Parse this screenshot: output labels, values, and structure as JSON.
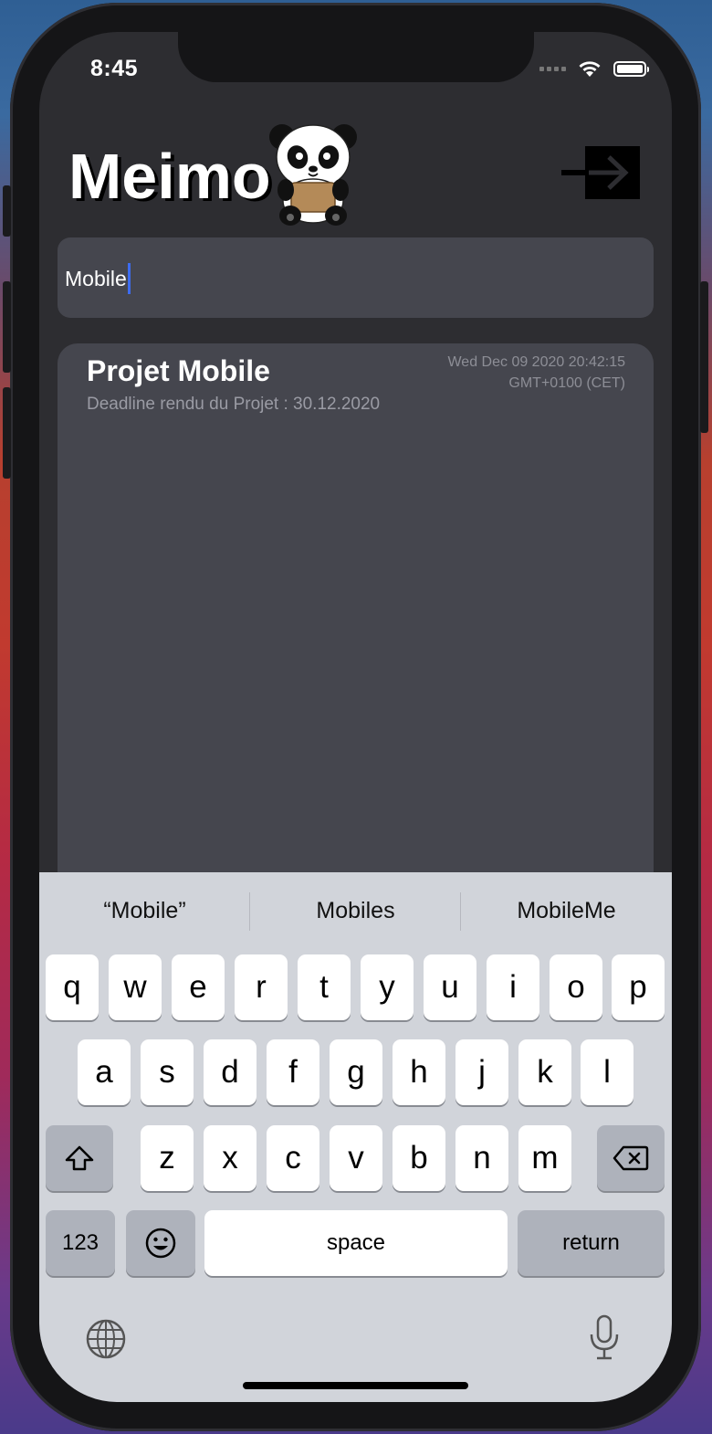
{
  "status_bar": {
    "time": "8:45"
  },
  "header": {
    "app_name": "Meimo"
  },
  "search": {
    "value": "Mobile"
  },
  "notes": [
    {
      "title": "Projet Mobile",
      "description": "Deadline rendu du Projet : 30.12.2020",
      "date_line1": "Wed Dec 09 2020 20:42:15",
      "date_line2": "GMT+0100 (CET)"
    }
  ],
  "keyboard": {
    "suggestions": [
      "“Mobile”",
      "Mobiles",
      "MobileMe"
    ],
    "row1": [
      "q",
      "w",
      "e",
      "r",
      "t",
      "y",
      "u",
      "i",
      "o",
      "p"
    ],
    "row2": [
      "a",
      "s",
      "d",
      "f",
      "g",
      "h",
      "j",
      "k",
      "l"
    ],
    "row3": [
      "z",
      "x",
      "c",
      "v",
      "b",
      "n",
      "m"
    ],
    "numbers_label": "123",
    "space_label": "space",
    "return_label": "return"
  },
  "icons": [
    "panda-logo",
    "logout-icon",
    "shift-icon",
    "delete-icon",
    "emoji-icon",
    "globe-icon",
    "microphone-icon"
  ]
}
